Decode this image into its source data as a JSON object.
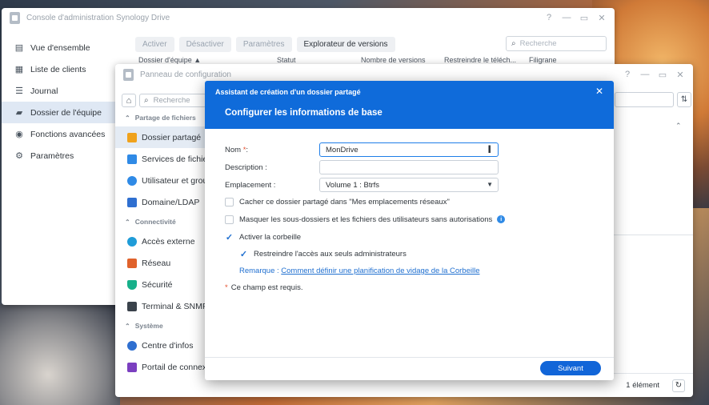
{
  "colors": {
    "accent": "#0f6bda",
    "required": "#e54f2f",
    "link": "#1f6fd0"
  },
  "drive_console": {
    "title": "Console d'administration Synology Drive",
    "sidebar": [
      {
        "label": "Vue d'ensemble",
        "icon": "overview-icon"
      },
      {
        "label": "Liste de clients",
        "icon": "client-list-icon"
      },
      {
        "label": "Journal",
        "icon": "log-icon"
      },
      {
        "label": "Dossier de l'équipe",
        "icon": "team-folder-icon",
        "active": true
      },
      {
        "label": "Fonctions avancées",
        "icon": "advanced-icon"
      },
      {
        "label": "Paramètres",
        "icon": "gear-icon"
      }
    ],
    "toolbar": {
      "enable": "Activer",
      "disable": "Désactiver",
      "settings": "Paramètres",
      "version_explorer": "Explorateur de versions"
    },
    "search_placeholder": "Recherche",
    "columns": [
      "Dossier d'équipe ▲",
      "Statut",
      "Nombre de versions",
      "Restreindre le téléch...",
      "Filigrane"
    ]
  },
  "control_panel": {
    "title": "Panneau de configuration",
    "search_placeholder": "Recherche",
    "sections": [
      {
        "label": "Partage de fichiers",
        "items": [
          {
            "label": "Dossier partagé",
            "color": "#f0a21c",
            "active": true
          },
          {
            "label": "Services de fichiers",
            "color": "#2f8ae6"
          },
          {
            "label": "Utilisateur et groupe",
            "color": "#2f8ae6"
          },
          {
            "label": "Domaine/LDAP",
            "color": "#2f6fd0"
          }
        ]
      },
      {
        "label": "Connectivité",
        "items": [
          {
            "label": "Accès externe",
            "color": "#1f9cd8"
          },
          {
            "label": "Réseau",
            "color": "#e0622b"
          },
          {
            "label": "Sécurité",
            "color": "#17b08a"
          },
          {
            "label": "Terminal & SNMP",
            "color": "#3a424b"
          }
        ]
      },
      {
        "label": "Système",
        "items": [
          {
            "label": "Centre d'infos",
            "color": "#2f6fd0"
          },
          {
            "label": "Portail de connexion",
            "color": "#7b3fc0"
          }
        ]
      }
    ],
    "footer_count": "1 élément"
  },
  "wizard": {
    "header": "Assistant de création d'un dossier partagé",
    "title": "Configurer les informations de base",
    "name_label": "Nom",
    "name_suffix": " :",
    "required_mark": "*",
    "name_value": "MonDrive",
    "description_label": "Description :",
    "description_value": "",
    "location_label": "Emplacement :",
    "location_value": "Volume 1 :  Btrfs",
    "hide_label": "Cacher ce dossier partagé dans \"Mes emplacements réseaux\"",
    "mask_label": "Masquer les sous-dossiers et les fichiers des utilisateurs sans autorisations",
    "recycle_label": "Activer la corbeille",
    "restrict_label": "Restreindre l'accès aux seuls administrateurs",
    "remark_label": "Remarque :",
    "remark_link": "Comment définir une planification de vidage de la Corbeille",
    "required_note": "Ce champ est requis.",
    "next_button": "Suivant"
  }
}
